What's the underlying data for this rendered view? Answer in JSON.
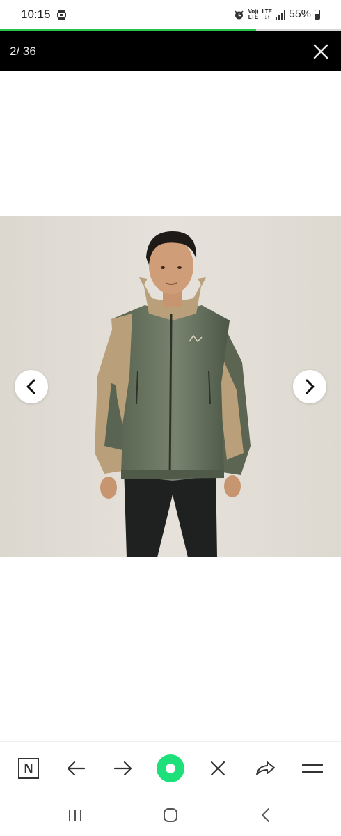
{
  "status_bar": {
    "time": "10:15",
    "volte_top": "Vo))",
    "volte_bottom": "LTE",
    "lte_top": "LTE",
    "lte_bottom": "↓↑",
    "battery_percent": "55%"
  },
  "page_load_progress": 0.75,
  "viewer": {
    "page_counter": "2/ 36"
  },
  "colors": {
    "progress": "#27c24c",
    "header_bg": "#000000",
    "accent_center_button": "#1ee07a",
    "jacket_green": "#5f6a57",
    "jacket_tan": "#b9a07a"
  },
  "icons": {
    "close": "close-icon",
    "prev": "chevron-left-icon",
    "next": "chevron-right-icon",
    "naver": "naver-n-icon",
    "back": "arrow-left-icon",
    "forward": "arrow-right-icon",
    "green_dot": "green-dot-icon",
    "close_tab": "x-icon",
    "share": "share-icon",
    "menu": "menu-icon",
    "recents": "recents-icon",
    "home": "home-icon",
    "system_back": "system-back-icon"
  },
  "toolbar": {
    "naver_label": "N"
  }
}
